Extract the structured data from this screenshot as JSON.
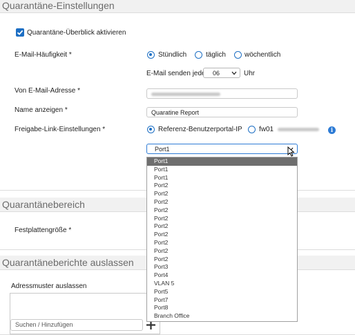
{
  "quarantine_settings": {
    "section_title": "Quarantäne-Einstellungen",
    "overview_checkbox_label": "Quarantäne-Überblick aktivieren",
    "overview_checked": true,
    "email_frequency": {
      "label": "E-Mail-Häufigkeit *",
      "options": [
        "Stündlich",
        "täglich",
        "wöchentlich"
      ],
      "selected": "Stündlich"
    },
    "send_every": {
      "label": "E-Mail senden jede",
      "value": "06",
      "unit": "Uhr"
    },
    "from_address": {
      "label": "Von E-Mail-Adresse *"
    },
    "display_name": {
      "label": "Name anzeigen *",
      "value": "Quaratine Report"
    },
    "release_link": {
      "label": "Freigabe-Link-Einstellungen *",
      "option_portal": "Referenz-Benutzerportal-IP",
      "option_host_prefix": "fw01",
      "selected": "Referenz-Benutzerportal-IP"
    },
    "port_select": {
      "value": "Port1",
      "options": [
        "Port1",
        "Port1",
        "Port1",
        "Port2",
        "Port2",
        "Port2",
        "Port2",
        "Port2",
        "Port2",
        "Port2",
        "Port2",
        "Port2",
        "Port2",
        "Port3",
        "Port4",
        "VLAN 5",
        "Port5",
        "Port7",
        "Port8",
        "Branch Office"
      ],
      "highlighted_index": 0
    }
  },
  "quarantine_area": {
    "section_title": "Quarantänebereich",
    "disk_size_label": "Festplattengröße *"
  },
  "omit_reports": {
    "section_title": "Quarantäneberichte auslassen",
    "address_pattern_label": "Adressmuster auslassen",
    "search_placeholder": "Suchen / Hinzufügen"
  },
  "colors": {
    "accent": "#1d6fc4",
    "header_bg": "#f1f1f1",
    "dropdown_highlight": "#6e6e6e"
  }
}
